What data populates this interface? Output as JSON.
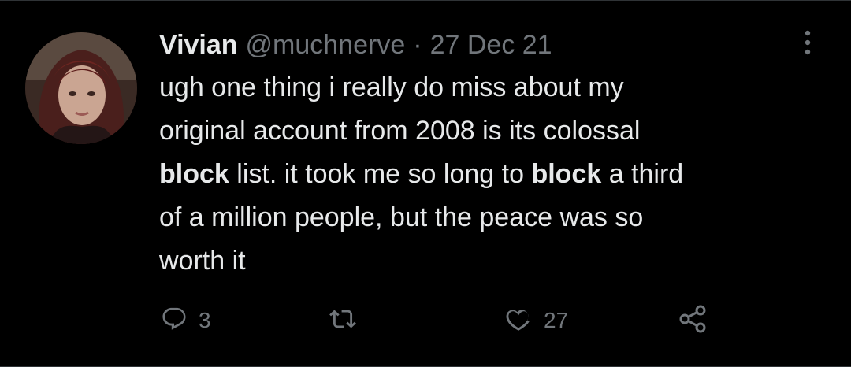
{
  "tweet": {
    "display_name": "Vivian",
    "handle": "@muchnerve",
    "separator": "·",
    "date": "27 Dec 21",
    "lines": [
      [
        {
          "t": "ugh one thing i really do miss about my",
          "b": false
        }
      ],
      [
        {
          "t": "original account from 2008 is its colossal",
          "b": false
        }
      ],
      [
        {
          "t": "block",
          "b": true
        },
        {
          "t": " list. it took me so long to ",
          "b": false
        },
        {
          "t": "block",
          "b": true
        },
        {
          "t": " a third",
          "b": false
        }
      ],
      [
        {
          "t": "of a million people, but the peace was so",
          "b": false
        }
      ],
      [
        {
          "t": "worth it",
          "b": false
        }
      ]
    ]
  },
  "actions": {
    "reply": {
      "icon": "reply-icon",
      "count": "3"
    },
    "retweet": {
      "icon": "retweet-icon",
      "count": ""
    },
    "like": {
      "icon": "heart-icon",
      "count": "27"
    },
    "share": {
      "icon": "share-icon",
      "count": ""
    }
  },
  "colors": {
    "background": "#000000",
    "text": "#e7e9ea",
    "secondary": "#71767b",
    "border": "#2f3336"
  }
}
